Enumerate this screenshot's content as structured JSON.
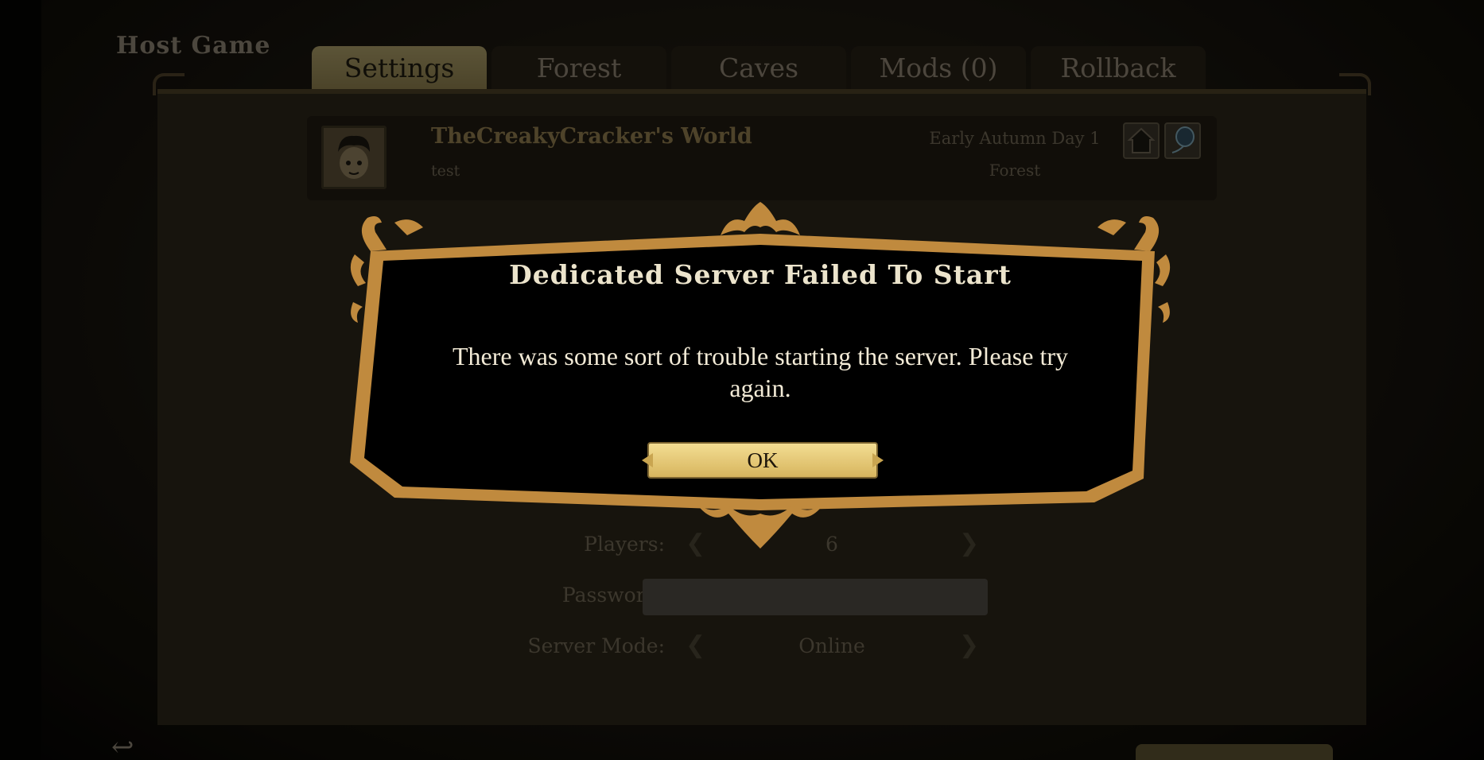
{
  "screen": {
    "title": "Host Game",
    "tabs": [
      {
        "label": "Settings",
        "active": true
      },
      {
        "label": "Forest",
        "active": false
      },
      {
        "label": "Caves",
        "active": false
      },
      {
        "label": "Mods (0)",
        "active": false
      },
      {
        "label": "Rollback",
        "active": false
      }
    ],
    "world": {
      "name": "TheCreakyCracker's World",
      "description": "test",
      "day": "Early Autumn Day 1",
      "shard": "Forest",
      "icons": [
        "ghost-house-icon",
        "balloon-icon"
      ]
    },
    "settings": {
      "players": {
        "label": "Players:",
        "value": "6"
      },
      "password": {
        "label": "Password:",
        "value": ""
      },
      "server_mode": {
        "label": "Server Mode:",
        "value": "Online"
      }
    }
  },
  "dialog": {
    "title": "Dedicated Server Failed To Start",
    "message": "There was some sort of trouble starting the server. Please try again.",
    "ok_label": "OK"
  },
  "colors": {
    "frame_gold": "#c08a3e",
    "button_gold": "#e6c676",
    "active_tab": "#a89a66"
  }
}
